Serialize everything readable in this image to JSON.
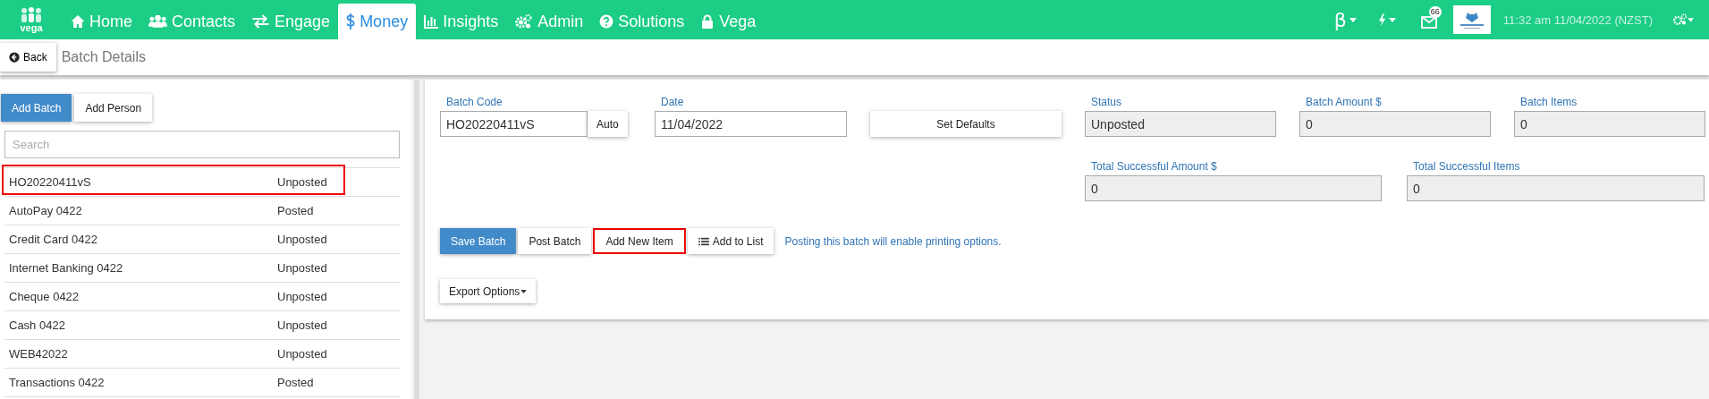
{
  "nav": {
    "logo_text": "vega",
    "items": [
      {
        "kind": "home",
        "label": "Home",
        "selected": false
      },
      {
        "kind": "contacts",
        "label": "Contacts",
        "selected": false
      },
      {
        "kind": "engage",
        "label": "Engage",
        "selected": false
      },
      {
        "kind": "money",
        "label": "Money",
        "selected": true
      },
      {
        "kind": "insights",
        "label": "Insights",
        "selected": false
      },
      {
        "kind": "admin",
        "label": "Admin",
        "selected": false
      },
      {
        "kind": "solutions",
        "label": "Solutions",
        "selected": false
      },
      {
        "kind": "vega",
        "label": "Vega",
        "selected": false
      }
    ],
    "beta": "β",
    "mail_badge": "66",
    "datetime": "11:32 am 11/04/2022 (NZST)"
  },
  "subbar": {
    "back": "Back",
    "title": "Batch Details"
  },
  "left": {
    "buttons": [
      {
        "label": "Add Batch",
        "primary": true
      },
      {
        "label": "Add Person",
        "primary": false
      }
    ],
    "search": {
      "placeholder": "Search"
    },
    "batches": [
      {
        "name": "HO20220411vS",
        "status": "Unposted",
        "highlighted": true
      },
      {
        "name": "AutoPay 0422",
        "status": "Posted",
        "highlighted": false
      },
      {
        "name": "Credit Card 0422",
        "status": "Unposted",
        "highlighted": false
      },
      {
        "name": "Internet Banking 0422",
        "status": "Unposted",
        "highlighted": false
      },
      {
        "name": "Cheque 0422",
        "status": "Unposted",
        "highlighted": false
      },
      {
        "name": "Cash 0422",
        "status": "Unposted",
        "highlighted": false
      },
      {
        "name": "WEB42022",
        "status": "Unposted",
        "highlighted": false
      },
      {
        "name": "Transactions 0422",
        "status": "Posted",
        "highlighted": false
      }
    ]
  },
  "form": {
    "batch_code": {
      "label": "Batch Code",
      "value": "HO20220411vS",
      "button": "Auto"
    },
    "date": {
      "label": "Date",
      "value": "11/04/2022"
    },
    "set_defaults": "Set Defaults",
    "summary": [
      {
        "label": "Status",
        "value": "Unposted"
      },
      {
        "label": "Batch Amount $",
        "value": "0"
      },
      {
        "label": "Batch Items",
        "value": "0"
      }
    ],
    "totals": [
      {
        "label": "Total Successful Amount $",
        "value": "0"
      },
      {
        "label": "Total Successful Items",
        "value": "0"
      }
    ],
    "actions": [
      {
        "kind": "primary",
        "label": "Save Batch",
        "highlighted": false
      },
      {
        "kind": "plain",
        "label": "Post Batch",
        "highlighted": false
      },
      {
        "kind": "plain",
        "label": "Add New Item",
        "highlighted": true
      },
      {
        "kind": "list",
        "label": "Add to List",
        "highlighted": false
      }
    ],
    "note": "Posting this batch will enable printing options.",
    "export": "Export Options"
  }
}
